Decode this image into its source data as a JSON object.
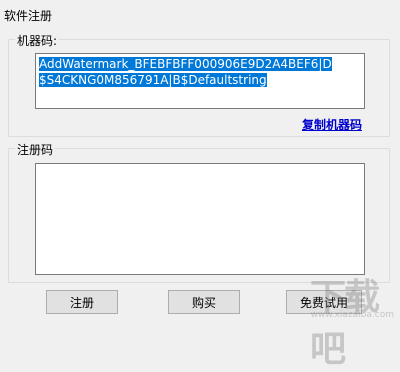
{
  "window": {
    "title": "软件注册"
  },
  "machine_group": {
    "label": "机器码:",
    "code_line1": "AddWatermark_BFEBFBFF000906E9D2A4BEF6|D",
    "code_line2": "$S4CKNG0M856791A|B$Defaultstring",
    "copy_link": "复制机器码"
  },
  "register_group": {
    "label": "注册码",
    "value": ""
  },
  "buttons": {
    "register": "注册",
    "buy": "购买",
    "trial": "免费试用"
  },
  "watermark": {
    "big": "下载吧",
    "small": "www.xiazaiba.com"
  }
}
